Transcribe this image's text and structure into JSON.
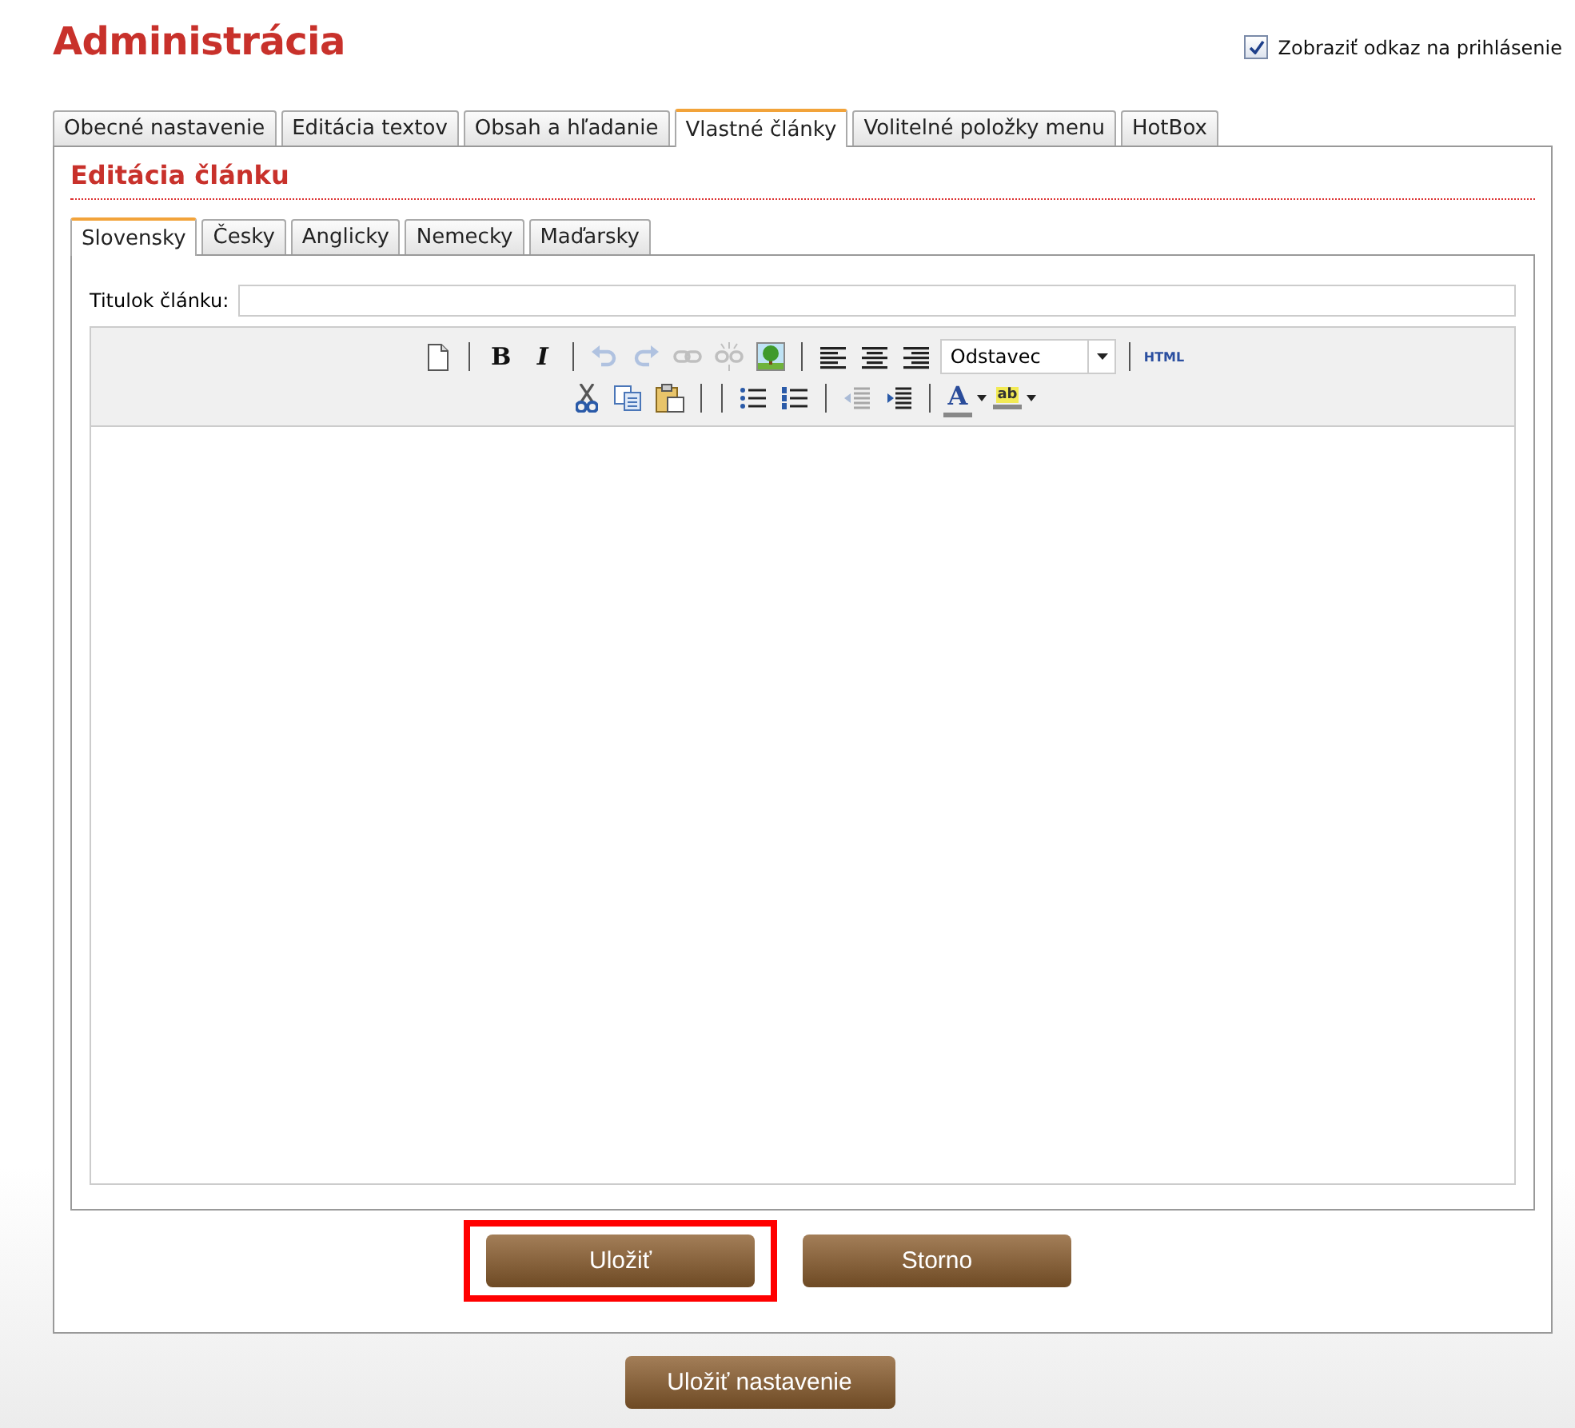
{
  "title": "Administrácia",
  "login_link_option": {
    "label": "Zobraziť odkaz na prihlásenie",
    "checked": true
  },
  "tabs": [
    {
      "label": "Obecné nastavenie",
      "selected": false
    },
    {
      "label": "Editácia textov",
      "selected": false
    },
    {
      "label": "Obsah a hľadanie",
      "selected": false
    },
    {
      "label": "Vlastné články",
      "selected": true
    },
    {
      "label": "Volitelné položky menu",
      "selected": false
    },
    {
      "label": "HotBox",
      "selected": false
    }
  ],
  "section_title": "Editácia článku",
  "language_tabs": [
    {
      "label": "Slovensky",
      "selected": true
    },
    {
      "label": "Česky",
      "selected": false
    },
    {
      "label": "Anglicky",
      "selected": false
    },
    {
      "label": "Nemecky",
      "selected": false
    },
    {
      "label": "Maďarsky",
      "selected": false
    }
  ],
  "title_field": {
    "label": "Titulok článku:"
  },
  "toolbar_rows": [
    [
      {
        "kind": "new-page",
        "disabled": false
      },
      {
        "kind": "separator"
      },
      {
        "kind": "bold",
        "label": "B",
        "disabled": false
      },
      {
        "kind": "italic",
        "label": "I",
        "disabled": false
      },
      {
        "kind": "separator"
      },
      {
        "kind": "undo",
        "disabled": true
      },
      {
        "kind": "redo",
        "disabled": true
      },
      {
        "kind": "link",
        "disabled": true
      },
      {
        "kind": "unlink",
        "disabled": true
      },
      {
        "kind": "image",
        "disabled": false
      },
      {
        "kind": "separator"
      },
      {
        "kind": "align-left",
        "disabled": false
      },
      {
        "kind": "align-center",
        "disabled": false
      },
      {
        "kind": "align-right",
        "disabled": false
      },
      {
        "kind": "select",
        "value": "Odstavec"
      },
      {
        "kind": "separator"
      },
      {
        "kind": "html",
        "label": "HTML",
        "disabled": false
      }
    ],
    [
      {
        "kind": "cut",
        "disabled": false
      },
      {
        "kind": "copy",
        "disabled": false
      },
      {
        "kind": "paste",
        "disabled": false
      },
      {
        "kind": "separator"
      },
      {
        "kind": "separator"
      },
      {
        "kind": "bullet-list",
        "disabled": false
      },
      {
        "kind": "numbered-list",
        "disabled": false
      },
      {
        "kind": "separator"
      },
      {
        "kind": "outdent",
        "disabled": true
      },
      {
        "kind": "indent",
        "disabled": false
      },
      {
        "kind": "separator"
      },
      {
        "kind": "font-color",
        "label": "A",
        "disabled": false
      },
      {
        "kind": "highlight",
        "label": "ab",
        "disabled": false
      }
    ]
  ],
  "form_buttons": [
    {
      "label": "Uložiť",
      "highlighted": true
    },
    {
      "label": "Storno",
      "highlighted": false
    }
  ],
  "save_settings_button": {
    "label": "Uložiť nastavenie"
  }
}
